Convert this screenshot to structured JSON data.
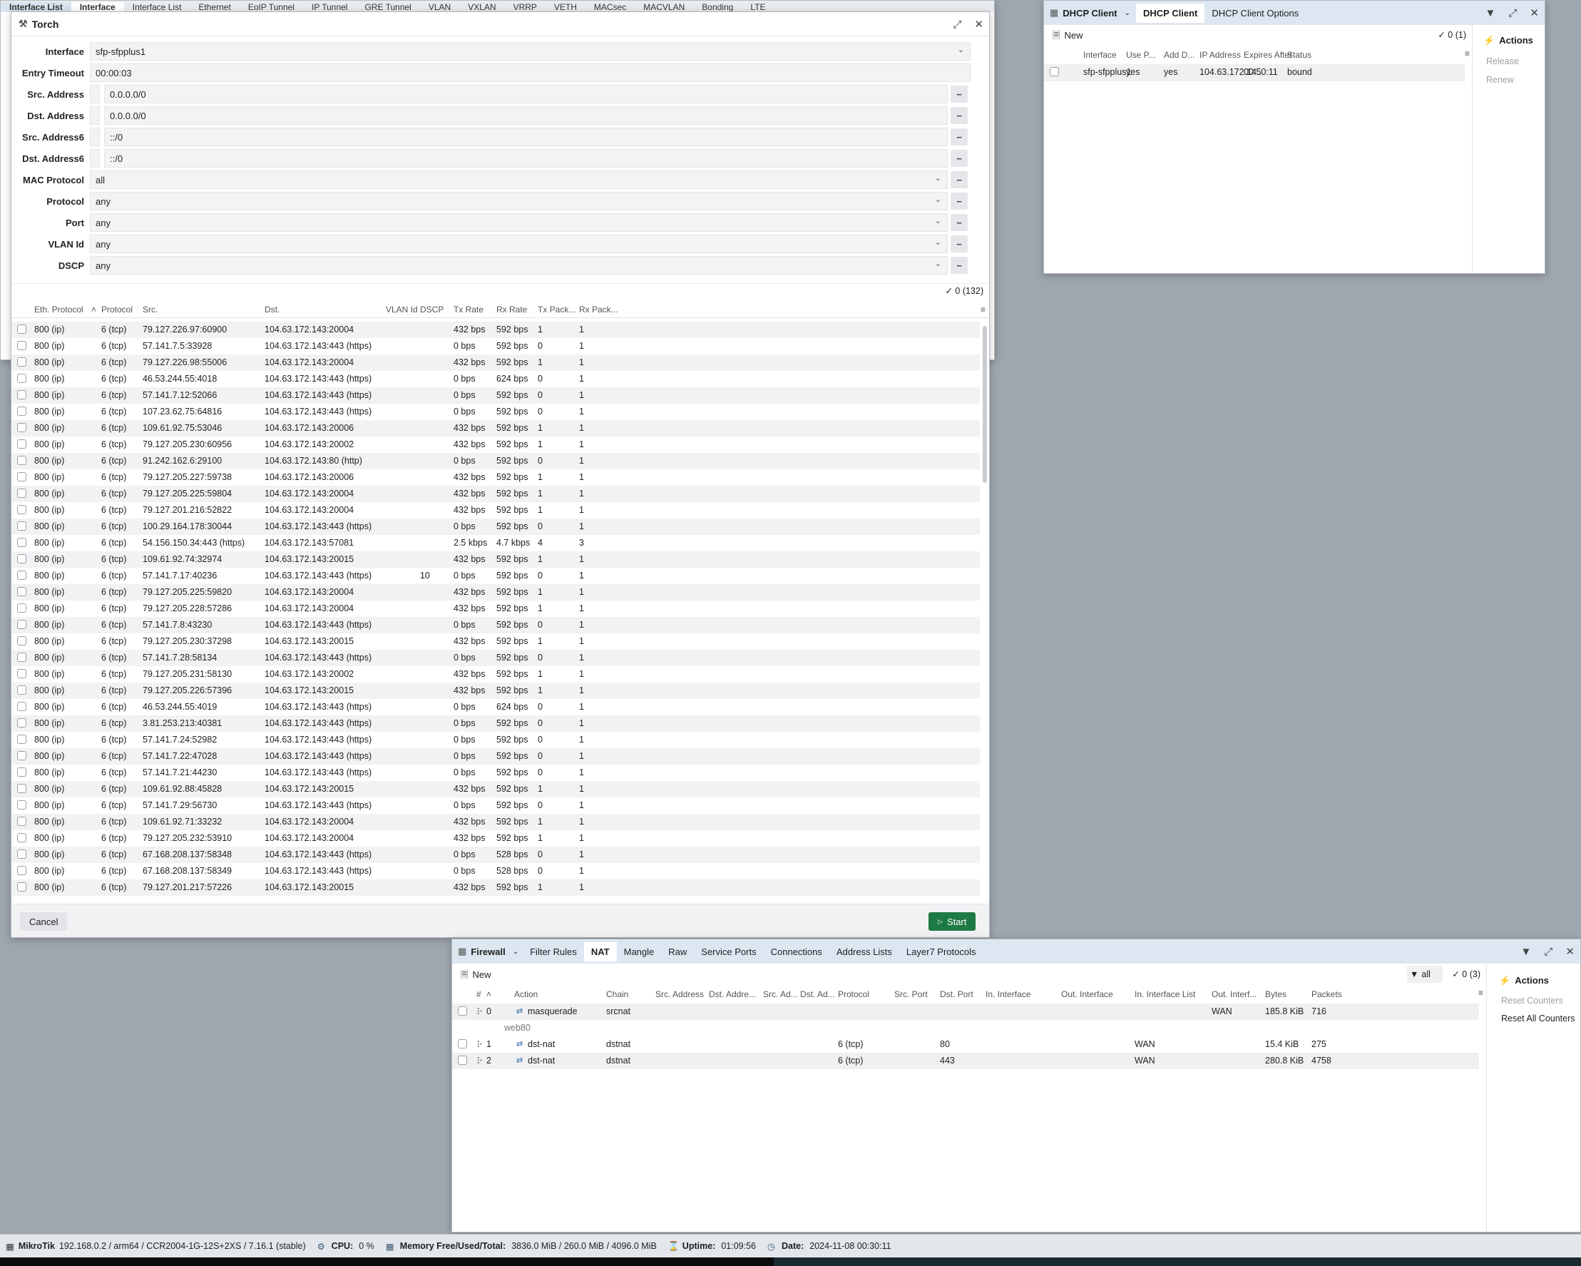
{
  "background": {
    "tabs": [
      "Interface List",
      "Interface",
      "Interface List",
      "Ethernet",
      "EoIP Tunnel",
      "IP Tunnel",
      "GRE Tunnel",
      "VLAN",
      "VXLAN",
      "VRRP",
      "VETH",
      "MACsec",
      "MACVLAN",
      "Bonding",
      "LTE"
    ]
  },
  "torch": {
    "title": "Torch",
    "fields": {
      "interface": {
        "label": "Interface",
        "value": "sfp-sfpplus1"
      },
      "entry_timeout": {
        "label": "Entry Timeout",
        "value": "00:00:03"
      },
      "src_address": {
        "label": "Src. Address",
        "value": "0.0.0.0/0"
      },
      "dst_address": {
        "label": "Dst. Address",
        "value": "0.0.0.0/0"
      },
      "src_address6": {
        "label": "Src. Address6",
        "value": "::/0"
      },
      "dst_address6": {
        "label": "Dst. Address6",
        "value": "::/0"
      },
      "mac_protocol": {
        "label": "MAC Protocol",
        "value": "all"
      },
      "protocol": {
        "label": "Protocol",
        "value": "any"
      },
      "port": {
        "label": "Port",
        "value": "any"
      },
      "vlan_id": {
        "label": "VLAN Id",
        "value": "any"
      },
      "dscp": {
        "label": "DSCP",
        "value": "any"
      }
    },
    "count": "0 (132)",
    "columns": [
      "Eth. Protocol",
      "Protocol",
      "Src.",
      "Dst.",
      "VLAN Id",
      "DSCP",
      "Tx Rate",
      "Rx Rate",
      "Tx Pack...",
      "Rx Pack..."
    ],
    "rows": [
      [
        "800 (ip)",
        "6 (tcp)",
        "79.127.226.97:60900",
        "104.63.172.143:20004",
        "",
        "",
        "432 bps",
        "592 bps",
        "1",
        "1"
      ],
      [
        "800 (ip)",
        "6 (tcp)",
        "57.141.7.5:33928",
        "104.63.172.143:443 (https)",
        "",
        "",
        "0 bps",
        "592 bps",
        "0",
        "1"
      ],
      [
        "800 (ip)",
        "6 (tcp)",
        "79.127.226.98:55006",
        "104.63.172.143:20004",
        "",
        "",
        "432 bps",
        "592 bps",
        "1",
        "1"
      ],
      [
        "800 (ip)",
        "6 (tcp)",
        "46.53.244.55:4018",
        "104.63.172.143:443 (https)",
        "",
        "",
        "0 bps",
        "624 bps",
        "0",
        "1"
      ],
      [
        "800 (ip)",
        "6 (tcp)",
        "57.141.7.12:52066",
        "104.63.172.143:443 (https)",
        "",
        "",
        "0 bps",
        "592 bps",
        "0",
        "1"
      ],
      [
        "800 (ip)",
        "6 (tcp)",
        "107.23.62.75:64816",
        "104.63.172.143:443 (https)",
        "",
        "",
        "0 bps",
        "592 bps",
        "0",
        "1"
      ],
      [
        "800 (ip)",
        "6 (tcp)",
        "109.61.92.75:53046",
        "104.63.172.143:20006",
        "",
        "",
        "432 bps",
        "592 bps",
        "1",
        "1"
      ],
      [
        "800 (ip)",
        "6 (tcp)",
        "79.127.205.230:60956",
        "104.63.172.143:20002",
        "",
        "",
        "432 bps",
        "592 bps",
        "1",
        "1"
      ],
      [
        "800 (ip)",
        "6 (tcp)",
        "91.242.162.6:29100",
        "104.63.172.143:80 (http)",
        "",
        "",
        "0 bps",
        "592 bps",
        "0",
        "1"
      ],
      [
        "800 (ip)",
        "6 (tcp)",
        "79.127.205.227:59738",
        "104.63.172.143:20006",
        "",
        "",
        "432 bps",
        "592 bps",
        "1",
        "1"
      ],
      [
        "800 (ip)",
        "6 (tcp)",
        "79.127.205.225:59804",
        "104.63.172.143:20004",
        "",
        "",
        "432 bps",
        "592 bps",
        "1",
        "1"
      ],
      [
        "800 (ip)",
        "6 (tcp)",
        "79.127.201.216:52822",
        "104.63.172.143:20004",
        "",
        "",
        "432 bps",
        "592 bps",
        "1",
        "1"
      ],
      [
        "800 (ip)",
        "6 (tcp)",
        "100.29.164.178:30044",
        "104.63.172.143:443 (https)",
        "",
        "",
        "0 bps",
        "592 bps",
        "0",
        "1"
      ],
      [
        "800 (ip)",
        "6 (tcp)",
        "54.156.150.34:443 (https)",
        "104.63.172.143:57081",
        "",
        "",
        "2.5 kbps",
        "4.7 kbps",
        "4",
        "3"
      ],
      [
        "800 (ip)",
        "6 (tcp)",
        "109.61.92.74:32974",
        "104.63.172.143:20015",
        "",
        "",
        "432 bps",
        "592 bps",
        "1",
        "1"
      ],
      [
        "800 (ip)",
        "6 (tcp)",
        "57.141.7.17:40236",
        "104.63.172.143:443 (https)",
        "",
        "10",
        "0 bps",
        "592 bps",
        "0",
        "1"
      ],
      [
        "800 (ip)",
        "6 (tcp)",
        "79.127.205.225:59820",
        "104.63.172.143:20004",
        "",
        "",
        "432 bps",
        "592 bps",
        "1",
        "1"
      ],
      [
        "800 (ip)",
        "6 (tcp)",
        "79.127.205.228:57286",
        "104.63.172.143:20004",
        "",
        "",
        "432 bps",
        "592 bps",
        "1",
        "1"
      ],
      [
        "800 (ip)",
        "6 (tcp)",
        "57.141.7.8:43230",
        "104.63.172.143:443 (https)",
        "",
        "",
        "0 bps",
        "592 bps",
        "0",
        "1"
      ],
      [
        "800 (ip)",
        "6 (tcp)",
        "79.127.205.230:37298",
        "104.63.172.143:20015",
        "",
        "",
        "432 bps",
        "592 bps",
        "1",
        "1"
      ],
      [
        "800 (ip)",
        "6 (tcp)",
        "57.141.7.28:58134",
        "104.63.172.143:443 (https)",
        "",
        "",
        "0 bps",
        "592 bps",
        "0",
        "1"
      ],
      [
        "800 (ip)",
        "6 (tcp)",
        "79.127.205.231:58130",
        "104.63.172.143:20002",
        "",
        "",
        "432 bps",
        "592 bps",
        "1",
        "1"
      ],
      [
        "800 (ip)",
        "6 (tcp)",
        "79.127.205.226:57396",
        "104.63.172.143:20015",
        "",
        "",
        "432 bps",
        "592 bps",
        "1",
        "1"
      ],
      [
        "800 (ip)",
        "6 (tcp)",
        "46.53.244.55:4019",
        "104.63.172.143:443 (https)",
        "",
        "",
        "0 bps",
        "624 bps",
        "0",
        "1"
      ],
      [
        "800 (ip)",
        "6 (tcp)",
        "3.81.253.213:40381",
        "104.63.172.143:443 (https)",
        "",
        "",
        "0 bps",
        "592 bps",
        "0",
        "1"
      ],
      [
        "800 (ip)",
        "6 (tcp)",
        "57.141.7.24:52982",
        "104.63.172.143:443 (https)",
        "",
        "",
        "0 bps",
        "592 bps",
        "0",
        "1"
      ],
      [
        "800 (ip)",
        "6 (tcp)",
        "57.141.7.22:47028",
        "104.63.172.143:443 (https)",
        "",
        "",
        "0 bps",
        "592 bps",
        "0",
        "1"
      ],
      [
        "800 (ip)",
        "6 (tcp)",
        "57.141.7.21:44230",
        "104.63.172.143:443 (https)",
        "",
        "",
        "0 bps",
        "592 bps",
        "0",
        "1"
      ],
      [
        "800 (ip)",
        "6 (tcp)",
        "109.61.92.88:45828",
        "104.63.172.143:20015",
        "",
        "",
        "432 bps",
        "592 bps",
        "1",
        "1"
      ],
      [
        "800 (ip)",
        "6 (tcp)",
        "57.141.7.29:56730",
        "104.63.172.143:443 (https)",
        "",
        "",
        "0 bps",
        "592 bps",
        "0",
        "1"
      ],
      [
        "800 (ip)",
        "6 (tcp)",
        "109.61.92.71:33232",
        "104.63.172.143:20004",
        "",
        "",
        "432 bps",
        "592 bps",
        "1",
        "1"
      ],
      [
        "800 (ip)",
        "6 (tcp)",
        "79.127.205.232:53910",
        "104.63.172.143:20004",
        "",
        "",
        "432 bps",
        "592 bps",
        "1",
        "1"
      ],
      [
        "800 (ip)",
        "6 (tcp)",
        "67.168.208.137:58348",
        "104.63.172.143:443 (https)",
        "",
        "",
        "0 bps",
        "528 bps",
        "0",
        "1"
      ],
      [
        "800 (ip)",
        "6 (tcp)",
        "67.168.208.137:58349",
        "104.63.172.143:443 (https)",
        "",
        "",
        "0 bps",
        "528 bps",
        "0",
        "1"
      ],
      [
        "800 (ip)",
        "6 (tcp)",
        "79.127.201.217:57226",
        "104.63.172.143:20015",
        "",
        "",
        "432 bps",
        "592 bps",
        "1",
        "1"
      ]
    ],
    "cancel_label": "Cancel",
    "start_label": "Start"
  },
  "dhcp": {
    "title": "DHCP Client",
    "tabs": [
      "DHCP Client",
      "DHCP Client Options"
    ],
    "new_label": "New",
    "count": "0 (1)",
    "columns": [
      "Interface",
      "Use P...",
      "Add D...",
      "IP Address",
      "Expires After",
      "Status"
    ],
    "rows": [
      [
        "sfp-sfpplus1",
        "yes",
        "yes",
        "104.63.172.14...",
        "00:50:11",
        "bound"
      ]
    ],
    "actions_title": "Actions",
    "actions": [
      "Release",
      "Renew"
    ]
  },
  "firewall": {
    "title": "Firewall",
    "tabs": [
      "Filter Rules",
      "NAT",
      "Mangle",
      "Raw",
      "Service Ports",
      "Connections",
      "Address Lists",
      "Layer7 Protocols"
    ],
    "new_label": "New",
    "filter_value": "all",
    "count": "0 (3)",
    "columns": [
      "#",
      "Action",
      "Chain",
      "Src. Address",
      "Dst. Addre...",
      "Src. Ad...",
      "Dst. Ad...",
      "Protocol",
      "Src. Port",
      "Dst. Port",
      "In. Interface",
      "Out. Interface",
      "In. Interface List",
      "Out. Interf...",
      "Bytes",
      "Packets"
    ],
    "comment": "web80",
    "rows": [
      {
        "n": "0",
        "action": "masquerade",
        "chain": "srcnat",
        "protocol": "",
        "dst_port": "",
        "in_list": "",
        "out_list": "WAN",
        "bytes": "185.8 KiB",
        "packets": "716"
      },
      {
        "n": "1",
        "action": "dst-nat",
        "chain": "dstnat",
        "protocol": "6 (tcp)",
        "dst_port": "80",
        "in_list": "WAN",
        "out_list": "",
        "bytes": "15.4 KiB",
        "packets": "275"
      },
      {
        "n": "2",
        "action": "dst-nat",
        "chain": "dstnat",
        "protocol": "6 (tcp)",
        "dst_port": "443",
        "in_list": "WAN",
        "out_list": "",
        "bytes": "280.8 KiB",
        "packets": "4758"
      }
    ],
    "actions_title": "Actions",
    "actions": [
      "Reset Counters",
      "Reset All Counters"
    ]
  },
  "status": {
    "brand": "MikroTik",
    "device": "192.168.0.2 / arm64 / CCR2004-1G-12S+2XS / 7.16.1 (stable)",
    "cpu_label": "CPU:",
    "cpu": "0 %",
    "mem_label": "Memory Free/Used/Total:",
    "mem": "3836.0 MiB / 260.0 MiB / 4096.0 MiB",
    "uptime_label": "Uptime:",
    "uptime": "01:09:56",
    "date_label": "Date:",
    "date": "2024-11-08 00:30:11"
  },
  "colors": {
    "accent": "#1e7a45",
    "tabbar": "#dce7f1",
    "row_alt": "#f1f2f4"
  }
}
